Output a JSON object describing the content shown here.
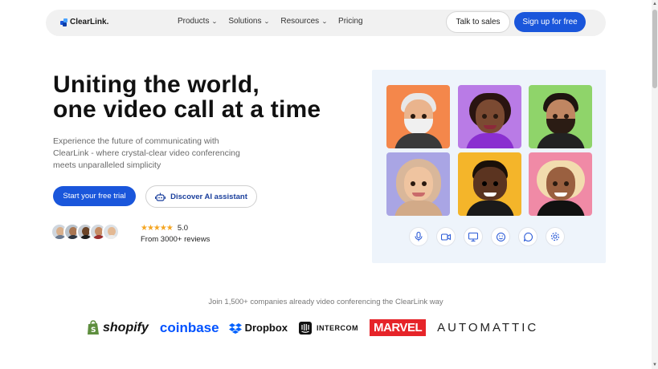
{
  "nav": {
    "brand": "ClearLink.",
    "links": [
      {
        "label": "Products",
        "has_menu": true
      },
      {
        "label": "Solutions",
        "has_menu": true
      },
      {
        "label": "Resources",
        "has_menu": true
      },
      {
        "label": "Pricing",
        "has_menu": false
      }
    ],
    "talk_label": "Talk to sales",
    "signup_label": "Sign up for free"
  },
  "hero": {
    "title_line1": "Uniting the world,",
    "title_line2": "one video call at a time",
    "subtitle": "Experience the future of communicating with ClearLink - where crystal-clear video conferencing meets unparalleled simplicity",
    "trial_label": "Start your free trial",
    "ai_label": "Discover AI assistant",
    "rating": "5.0",
    "stars": "★★★★★",
    "reviews": "From 3000+ reviews"
  },
  "controls": [
    "microphone-icon",
    "camera-icon",
    "screen-share-icon",
    "emoji-icon",
    "chat-icon",
    "settings-icon"
  ],
  "companies": {
    "intro": "Join 1,500+ companies already video conferencing the ClearLink way",
    "logos": [
      "shopify",
      "coinbase",
      "Dropbox",
      "INTERCOM",
      "MARVEL",
      "AUTOMATTIC"
    ]
  },
  "colors": {
    "accent": "#1a56db",
    "panel": "#eef4fb",
    "star": "#f5a623"
  }
}
